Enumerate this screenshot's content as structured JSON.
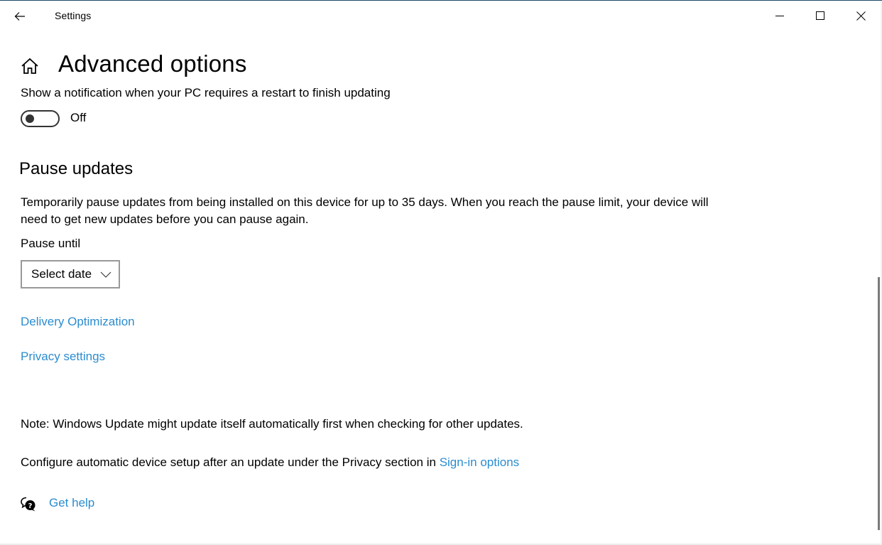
{
  "window": {
    "title": "Settings",
    "controls": {
      "minimize": "minimize",
      "maximize": "maximize",
      "close": "close"
    }
  },
  "header": {
    "title": "Advanced options",
    "icon": "home-icon"
  },
  "restart_notification": {
    "label": "Show a notification when your PC requires a restart to finish updating",
    "toggle_on": false,
    "state_label": "Off"
  },
  "pause_updates": {
    "heading": "Pause updates",
    "description": "Temporarily pause updates from being installed on this device for up to 35 days. When you reach the pause limit, your device will need to get new updates before you can pause again.",
    "pause_until_label": "Pause until",
    "dropdown": {
      "selected": "Select date"
    }
  },
  "links": {
    "delivery_optimization": "Delivery Optimization",
    "privacy_settings": "Privacy settings"
  },
  "notes": {
    "note": "Note: Windows Update might update itself automatically first when checking for other updates.",
    "configure_prefix": "Configure automatic device setup after an update under the Privacy section in ",
    "configure_link": "Sign-in options"
  },
  "help": {
    "label": "Get help",
    "icon": "help-chat-icon"
  },
  "colors": {
    "link": "#2b8ccf",
    "text": "#000000",
    "toggle_off": "#333333",
    "dropdown_border": "#999999",
    "window_border_top": "#1b4a66"
  }
}
